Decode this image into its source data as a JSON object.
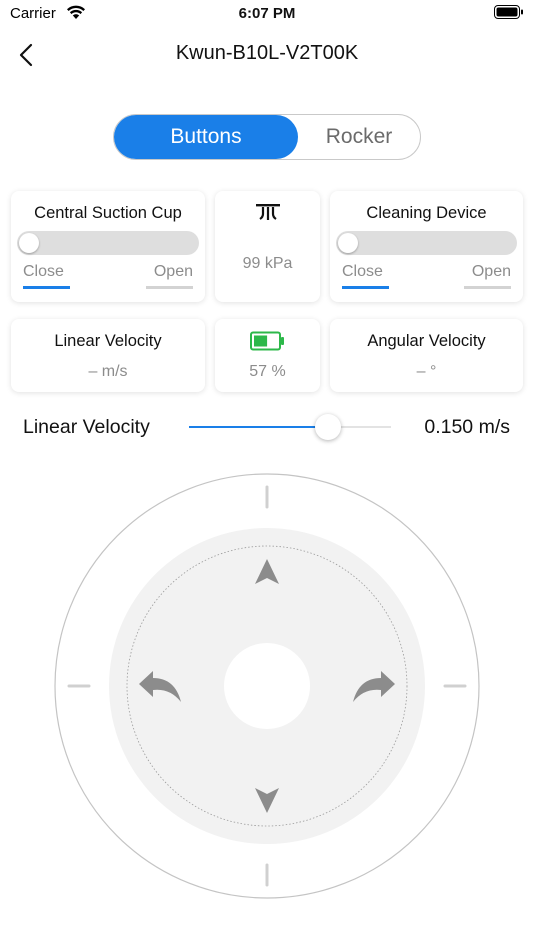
{
  "status_bar": {
    "carrier": "Carrier",
    "time": "6:07 PM"
  },
  "nav": {
    "title": "Kwun-B10L-V2T00K"
  },
  "mode_tabs": [
    {
      "label": "Buttons",
      "active": true
    },
    {
      "label": "Rocker",
      "active": false
    }
  ],
  "suction_cup": {
    "title": "Central Suction Cup",
    "close_label": "Close",
    "open_label": "Open",
    "selected": "Close"
  },
  "pressure": {
    "icon": "suction-pressure-icon",
    "value": "99 kPa"
  },
  "cleaning_device": {
    "title": "Cleaning Device",
    "close_label": "Close",
    "open_label": "Open",
    "selected": "Close"
  },
  "linear_velocity": {
    "title": "Linear Velocity",
    "value": "– m/s"
  },
  "battery": {
    "icon": "battery-icon",
    "value": "57 %",
    "level": 0.57
  },
  "angular_velocity": {
    "title": "Angular Velocity",
    "value": "– °"
  },
  "velocity_slider": {
    "label": "Linear Velocity",
    "value_text": "0.150 m/s",
    "fraction": 0.69
  },
  "joystick": {
    "buttons": [
      "forward-arrow-icon",
      "backward-arrow-icon",
      "turn-left-icon",
      "turn-right-icon"
    ]
  },
  "colors": {
    "accent": "#1a7fe8",
    "battery_green": "#2db84a",
    "muted_text": "#8c8c8c"
  }
}
